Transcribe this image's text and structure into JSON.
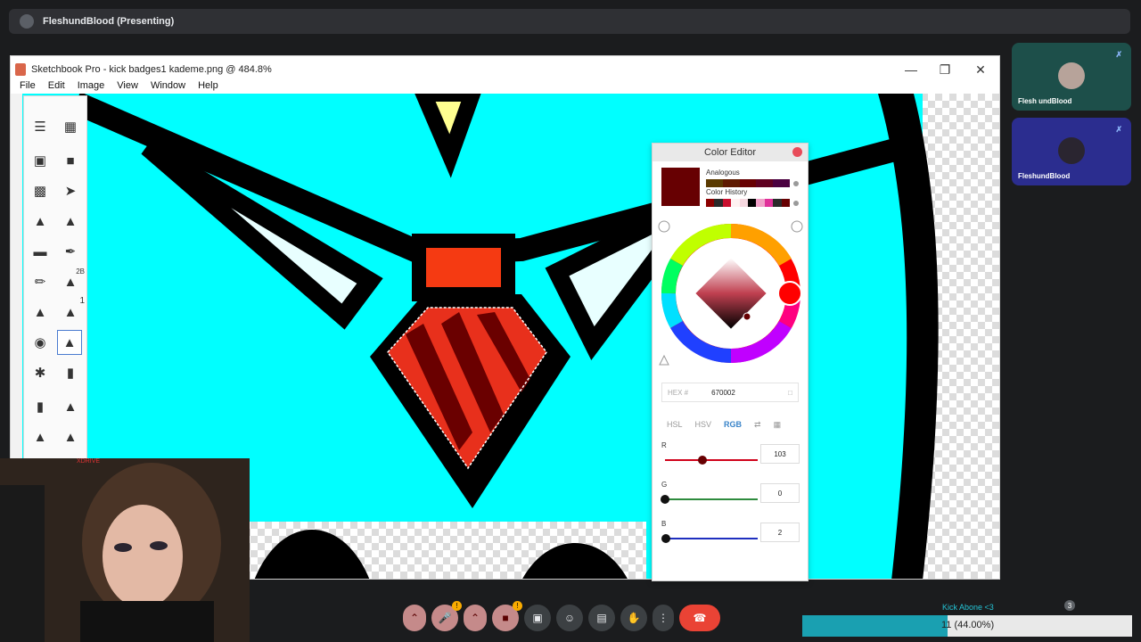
{
  "meet": {
    "presenting_title": "FleshundBlood (Presenting)",
    "participants": [
      {
        "name": "Flesh undBlood",
        "muted": true
      },
      {
        "name": "FleshundBlood",
        "muted": true
      }
    ],
    "controls": [
      {
        "name": "mic-options",
        "icon": "chevron-up-icon"
      },
      {
        "name": "mic-toggle",
        "icon": "mic-off-icon",
        "badge": "!"
      },
      {
        "name": "camera-options",
        "icon": "chevron-up-icon"
      },
      {
        "name": "camera-toggle",
        "icon": "camera-off-icon",
        "badge": "!"
      },
      {
        "name": "present",
        "icon": "present-screen-icon"
      },
      {
        "name": "reactions",
        "icon": "smile-icon"
      },
      {
        "name": "captions",
        "icon": "captions-icon"
      },
      {
        "name": "raise-hand",
        "icon": "hand-icon"
      },
      {
        "name": "more-options",
        "icon": "more-vertical-icon"
      },
      {
        "name": "leave-call",
        "icon": "phone-hangup-icon"
      }
    ],
    "people_count": "3"
  },
  "app": {
    "title": "Sketchbook Pro - kick badges1 kademe.png @ 484.8%",
    "menu": [
      "File",
      "Edit",
      "Image",
      "View",
      "Window",
      "Help"
    ],
    "tool_labels": {
      "pencil_size": "2B",
      "pen_size": "1"
    }
  },
  "color_editor": {
    "title": "Color Editor",
    "current_color": "#670002",
    "analogous_label": "Analogous",
    "analogous": [
      "#5a3a00",
      "#5e1a00",
      "#670002",
      "#5e0020",
      "#4a0040"
    ],
    "history_label": "Color History",
    "history": [
      "#8b0000",
      "#2a2a2a",
      "#c8102e",
      "#fff2f2",
      "#f6d8e0",
      "#000000",
      "#f0a0c8",
      "#e0309a",
      "#2a2a2a",
      "#670002"
    ],
    "hex_label": "HEX #",
    "hex_value": "670002",
    "modes": [
      "HSL",
      "HSV",
      "RGB"
    ],
    "active_mode": "RGB",
    "channels": [
      {
        "label": "R",
        "value": "103",
        "fraction": 0.404,
        "color": "#d0021b"
      },
      {
        "label": "G",
        "value": "0",
        "fraction": 0.0,
        "color": "#2e8b3e"
      },
      {
        "label": "B",
        "value": "2",
        "fraction": 0.008,
        "color": "#1f2fbf"
      }
    ]
  },
  "overlay": {
    "progress_label": "Kick Abone <3",
    "progress_text": "11 (44.00%)",
    "progress_fraction": 0.44,
    "webcam_tag": "XDRIVE"
  }
}
